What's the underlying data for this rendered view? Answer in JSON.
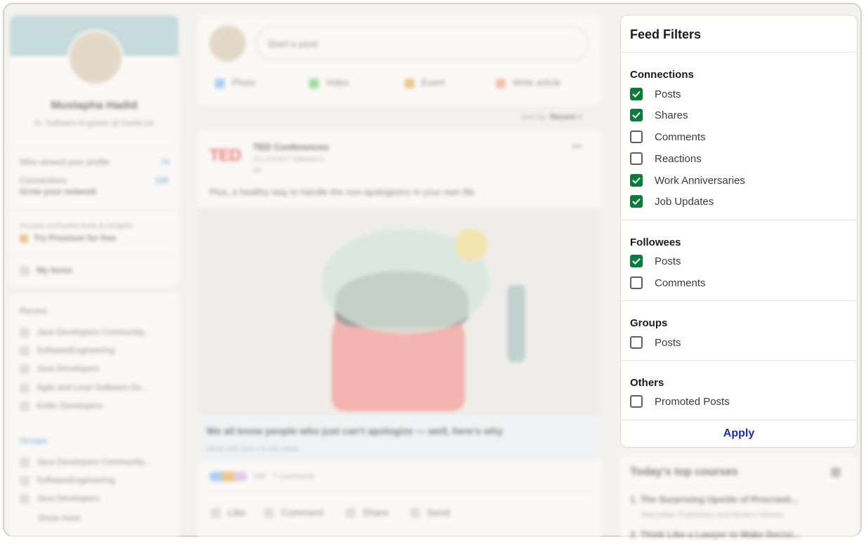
{
  "profile": {
    "name": "Mustapha Hadid",
    "headline": "Sr. Software Engineer @ EarthLink",
    "stats": [
      {
        "label": "Who viewed your profile",
        "value": "74"
      },
      {
        "label": "Connections",
        "value": "186"
      }
    ],
    "grow_label": "Grow your network",
    "premium_prompt": "Access exclusive tools & insights",
    "premium_link": "Try Premium for free",
    "my_items": "My Items"
  },
  "recent": {
    "title": "Recent",
    "items": [
      "Java Developers Community...",
      "SoftwareEngineering",
      "Java Developers",
      "Agile and Lean Software De...",
      "Kotlin Developers"
    ]
  },
  "groups": {
    "title": "Groups",
    "items": [
      "Java Developers Community...",
      "SoftwareEngineering",
      "Java Developers"
    ],
    "show_more": "Show more"
  },
  "composer": {
    "placeholder": "Start a post",
    "actions": [
      "Photo",
      "Video",
      "Event",
      "Write article"
    ]
  },
  "sort": {
    "label": "Sort by:",
    "value": "Recent"
  },
  "post": {
    "author": "TED Conferences",
    "followers": "21,119,637 followers",
    "time": "4h",
    "logo": "TED",
    "text": "Plus, a healthy way to handle the non-apologizers in your own life.",
    "link_title": "We all know people who just can't apologize — well, here's why",
    "link_source": "ideas.ted.com • 5 min read",
    "reactions": "186 · 7 comments",
    "actions": [
      "Like",
      "Comment",
      "Share",
      "Send"
    ]
  },
  "courses": {
    "title": "Today's top courses",
    "items": [
      {
        "title": "1. The Surprising Upside of Procrasti...",
        "by": "Macmillan Publishers and Modern Mentor"
      },
      {
        "title": "2. Think Like a Lawyer to Make Decisi...",
        "by": ""
      }
    ]
  },
  "filters": {
    "title": "Feed Filters",
    "apply_label": "Apply",
    "check_color": "#0b7a3b",
    "sections": [
      {
        "title": "Connections",
        "options": [
          {
            "label": "Posts",
            "checked": true
          },
          {
            "label": "Shares",
            "checked": true
          },
          {
            "label": "Comments",
            "checked": false
          },
          {
            "label": "Reactions",
            "checked": false
          },
          {
            "label": "Work Anniversaries",
            "checked": true
          },
          {
            "label": "Job Updates",
            "checked": true
          }
        ]
      },
      {
        "title": "Followees",
        "options": [
          {
            "label": "Posts",
            "checked": true
          },
          {
            "label": "Comments",
            "checked": false
          }
        ]
      },
      {
        "title": "Groups",
        "options": [
          {
            "label": "Posts",
            "checked": false
          }
        ]
      },
      {
        "title": "Others",
        "options": [
          {
            "label": "Promoted Posts",
            "checked": false
          }
        ]
      }
    ]
  }
}
